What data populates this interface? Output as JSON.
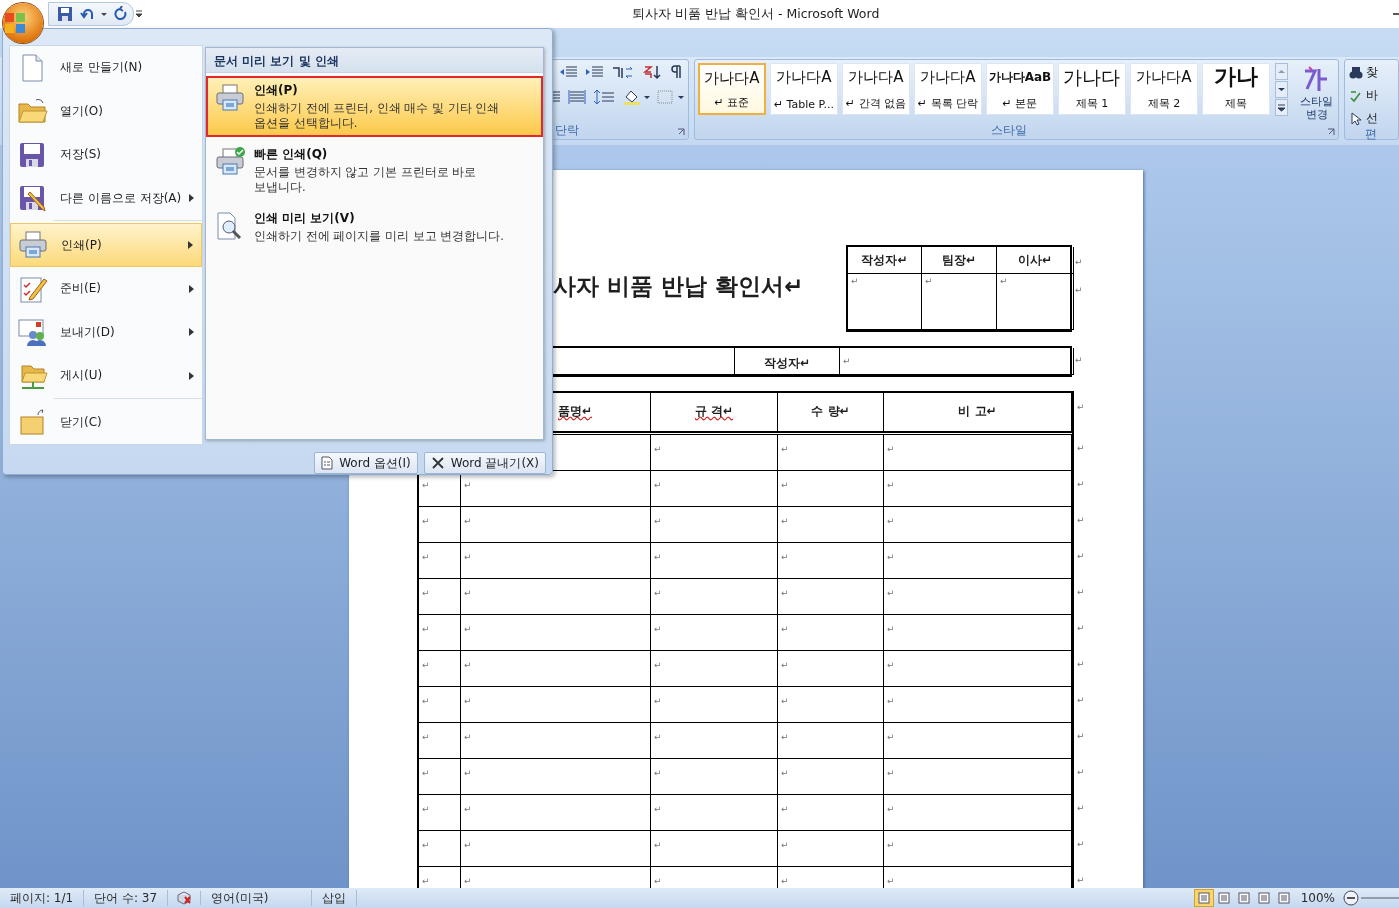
{
  "window": {
    "title": "퇴사자 비품 반납 확인서 - Microsoft Word"
  },
  "ribbon": {
    "paragraph_group": {
      "label": "단락"
    },
    "styles_group": {
      "label": "스타일",
      "change_style": "스타일\n변경",
      "styles": [
        {
          "preview": "가나다A",
          "name": "↵ 표준",
          "kind": "normal",
          "selected": true
        },
        {
          "preview": "가나다A",
          "name": "↵ Table P...",
          "kind": "normal",
          "selected": false
        },
        {
          "preview": "가나다A",
          "name": "↵ 간격 없음",
          "kind": "normal",
          "selected": false
        },
        {
          "preview": "가나다A",
          "name": "↵ 목록 단락",
          "kind": "normal",
          "selected": false
        },
        {
          "preview": "가나다AaB",
          "name": "↵ 본문",
          "kind": "bold",
          "selected": false
        },
        {
          "preview": "가나다",
          "name": "제목 1",
          "kind": "heading",
          "selected": false
        },
        {
          "preview": "가나다A",
          "name": "제목 2",
          "kind": "normal",
          "selected": false
        },
        {
          "preview": "가나",
          "name": "제목",
          "kind": "title",
          "selected": false
        }
      ]
    },
    "editing_group": {
      "label": "편",
      "items": [
        "찾",
        "바",
        "선"
      ]
    }
  },
  "document": {
    "title": "사자 비품 반납 확인서↵",
    "approval_table": {
      "headers": [
        "작성자↵",
        "팀장↵",
        "이사↵"
      ],
      "cells": [
        "↵",
        "↵",
        "↵"
      ],
      "row_ends": [
        "↵",
        "↵"
      ]
    },
    "writer_row": {
      "cells": [
        "작성자↵",
        "↵"
      ],
      "end": "↵"
    },
    "items_table": {
      "headers": [
        {
          "text": "품명↵",
          "spell_error": true
        },
        {
          "text": "규 격↵",
          "spell_error": true
        },
        {
          "text": "수 량↵",
          "spell_error": false
        },
        {
          "text": "비 고↵",
          "spell_error": false
        }
      ],
      "header_end": "↵",
      "rows": [
        {
          "cells": [
            null,
            null,
            "↵",
            "↵",
            "↵"
          ],
          "end": "↵"
        },
        {
          "cells": [
            "↵",
            "↵",
            "↵",
            "↵",
            "↵"
          ],
          "end": "↵"
        },
        {
          "cells": [
            "↵",
            "↵",
            "↵",
            "↵",
            "↵"
          ],
          "end": "↵"
        },
        {
          "cells": [
            "↵",
            "↵",
            "↵",
            "↵",
            "↵"
          ],
          "end": "↵"
        },
        {
          "cells": [
            "↵",
            "↵",
            "↵",
            "↵",
            "↵"
          ],
          "end": "↵"
        },
        {
          "cells": [
            "↵",
            "↵",
            "↵",
            "↵",
            "↵"
          ],
          "end": "↵"
        },
        {
          "cells": [
            "↵",
            "↵",
            "↵",
            "↵",
            "↵"
          ],
          "end": "↵"
        },
        {
          "cells": [
            "↵",
            "↵",
            "↵",
            "↵",
            "↵"
          ],
          "end": "↵"
        },
        {
          "cells": [
            "↵",
            "↵",
            "↵",
            "↵",
            "↵"
          ],
          "end": "↵"
        },
        {
          "cells": [
            "↵",
            "↵",
            "↵",
            "↵",
            "↵"
          ],
          "end": "↵"
        },
        {
          "cells": [
            "↵",
            "↵",
            "↵",
            "↵",
            "↵"
          ],
          "end": "↵"
        },
        {
          "cells": [
            "↵",
            "↵",
            "↵",
            "↵",
            "↵"
          ],
          "end": "↵"
        },
        {
          "cells": [
            "↵",
            "↵",
            "↵",
            "↵",
            "↵"
          ],
          "end": "↵"
        }
      ]
    }
  },
  "office_menu": {
    "items": [
      {
        "label": "새로 만들기(N)",
        "submenu": false,
        "selected": false
      },
      {
        "label": "열기(O)",
        "submenu": false,
        "selected": false
      },
      {
        "label": "저장(S)",
        "submenu": false,
        "selected": false
      },
      {
        "label": "다른 이름으로 저장(A)",
        "submenu": true,
        "selected": false
      },
      {
        "label": "인쇄(P)",
        "submenu": true,
        "selected": true
      },
      {
        "label": "준비(E)",
        "submenu": true,
        "selected": false
      },
      {
        "label": "보내기(D)",
        "submenu": true,
        "selected": false
      },
      {
        "label": "게시(U)",
        "submenu": true,
        "selected": false
      },
      {
        "label": "닫기(C)",
        "submenu": false,
        "selected": false
      }
    ],
    "panel": {
      "title": "문서 미리 보기 및 인쇄",
      "items": [
        {
          "title": "인쇄(P)",
          "description": "인쇄하기 전에 프린터, 인쇄 매수 및 기타 인쇄\n옵션을 선택합니다.",
          "selected": true,
          "annotated": true
        },
        {
          "title": "빠른 인쇄(Q)",
          "description": "문서를 변경하지 않고 기본 프린터로 바로\n보냅니다.",
          "selected": false,
          "annotated": false
        },
        {
          "title": "인쇄 미리 보기(V)",
          "description": "인쇄하기 전에 페이지를 미리 보고 변경합니다.",
          "selected": false,
          "annotated": false
        }
      ]
    },
    "buttons": [
      "Word 옵션(I)",
      "Word 끝내기(X)"
    ]
  },
  "status_bar": {
    "page": "페이지: 1/1",
    "words": "단어 수: 37",
    "language": "영어(미국)",
    "mode": "삽입",
    "views": [
      {
        "selected": true
      },
      {
        "selected": false
      },
      {
        "selected": false
      },
      {
        "selected": false
      },
      {
        "selected": false
      }
    ],
    "zoom": "100%"
  }
}
